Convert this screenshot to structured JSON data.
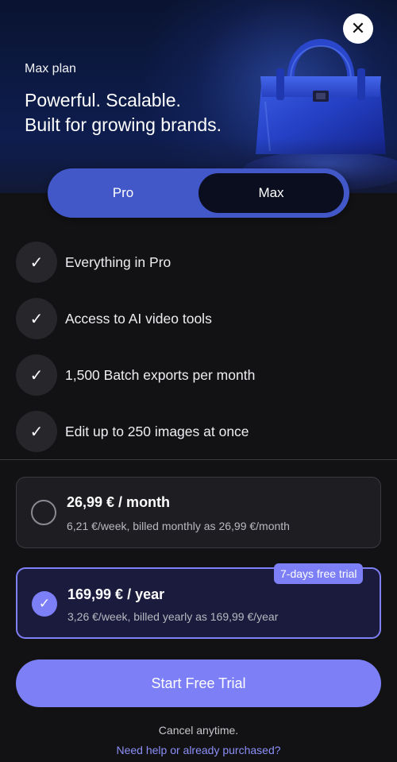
{
  "hero": {
    "plan_label": "Max plan",
    "headline_line1": "Powerful. Scalable.",
    "headline_line2": "Built for growing brands."
  },
  "close_button": {
    "glyph": "✕",
    "icon": "close-icon"
  },
  "toggle": {
    "options": [
      {
        "label": "Pro",
        "selected": false
      },
      {
        "label": "Max",
        "selected": true
      }
    ]
  },
  "features": [
    {
      "text": "Everything in Pro",
      "icon": "check-icon"
    },
    {
      "text": "Access to AI video tools",
      "icon": "check-icon"
    },
    {
      "text": "1,500 Batch exports per month",
      "icon": "check-icon"
    },
    {
      "text": "Edit up to 250 images at once",
      "icon": "check-icon"
    }
  ],
  "plans": {
    "monthly": {
      "price": "26,99 € / month",
      "detail": "6,21 €/week, billed monthly as 26,99 €/month",
      "selected": false
    },
    "yearly": {
      "price": "169,99 € / year",
      "detail": "3,26 €/week, billed yearly as 169,99 €/year",
      "badge": "7-days free trial",
      "selected": true
    }
  },
  "cta_label": "Start Free Trial",
  "cancel_note": "Cancel anytime.",
  "help_link": "Need help or already purchased?",
  "colors": {
    "accent": "#7c7ff5",
    "toggle_bg": "#4258c9",
    "background": "#121214",
    "link": "#8c8ff7"
  }
}
